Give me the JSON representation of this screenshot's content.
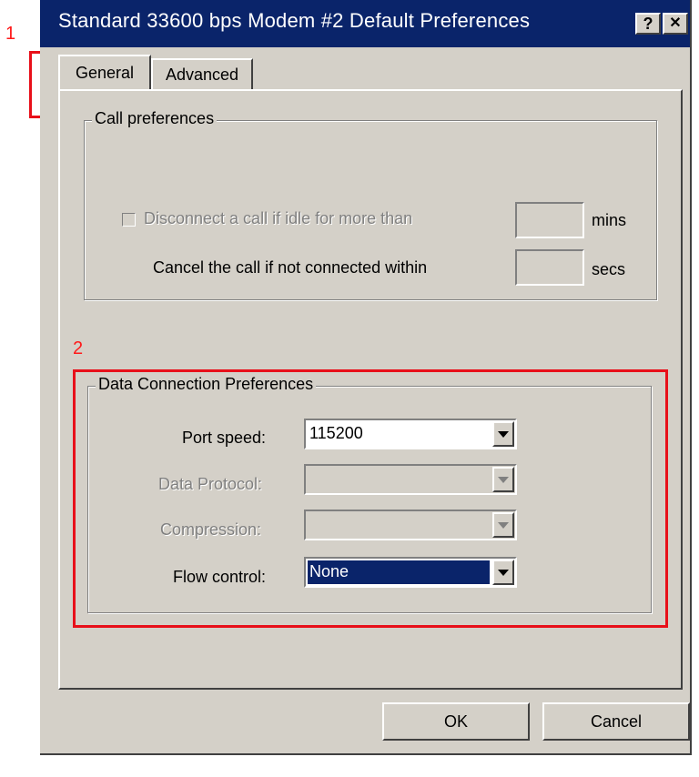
{
  "annotations": {
    "marker_1": "1",
    "marker_2": "2",
    "color": "#e8101a"
  },
  "window": {
    "title": "Standard 33600 bps Modem #2 Default Preferences",
    "help_label": "?",
    "close_label": "✕",
    "titlebar_color": "#0a246a",
    "face_color": "#d4d0c8"
  },
  "tabs": [
    {
      "label": "General",
      "active": true
    },
    {
      "label": "Advanced",
      "active": false
    }
  ],
  "call_preferences": {
    "legend": "Call preferences",
    "disconnect_label": "Disconnect a call if idle for more than",
    "disconnect_checked": false,
    "disconnect_enabled": false,
    "disconnect_value": "",
    "disconnect_unit": "mins",
    "cancel_label": "Cancel the call if not connected within",
    "cancel_value": "",
    "cancel_unit": "secs"
  },
  "data_connection": {
    "legend": "Data Connection Preferences",
    "port_speed_label": "Port speed:",
    "port_speed_value": "115200",
    "data_protocol_label": "Data Protocol:",
    "data_protocol_value": "",
    "compression_label": "Compression:",
    "compression_value": "",
    "flow_control_label": "Flow control:",
    "flow_control_value": "None"
  },
  "buttons": {
    "ok": "OK",
    "cancel": "Cancel"
  }
}
